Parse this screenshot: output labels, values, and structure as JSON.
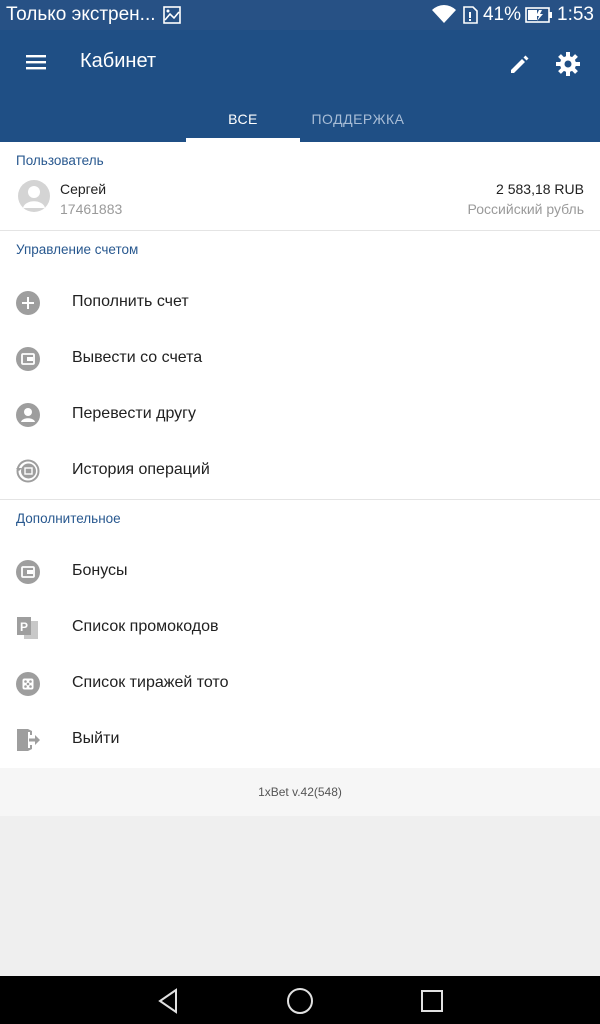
{
  "status_bar": {
    "notification_text": "Только экстрен...",
    "battery": "41%",
    "time": "1:53"
  },
  "app_bar": {
    "title": "Кабинет",
    "tabs": [
      {
        "label": "ВСЕ",
        "selected": true
      },
      {
        "label": "ПОДДЕРЖКА",
        "selected": false
      }
    ]
  },
  "user_section": {
    "label": "Пользователь",
    "name": "Сергей",
    "id": "17461883",
    "balance": "2 583,18 RUB",
    "currency_name": "Российский рубль"
  },
  "account_section": {
    "label": "Управление счетом",
    "items": [
      {
        "label": "Пополнить счет",
        "icon": "add-circle-icon"
      },
      {
        "label": "Вывести со счета",
        "icon": "wallet-icon"
      },
      {
        "label": "Перевести другу",
        "icon": "person-icon"
      },
      {
        "label": "История операций",
        "icon": "history-icon"
      }
    ]
  },
  "extra_section": {
    "label": "Дополнительное",
    "items": [
      {
        "label": "Бонусы",
        "icon": "bonus-wallet-icon"
      },
      {
        "label": "Список промокодов",
        "icon": "promo-code-icon"
      },
      {
        "label": "Список тиражей тото",
        "icon": "dice-icon"
      },
      {
        "label": "Выйти",
        "icon": "logout-icon"
      }
    ]
  },
  "footer": {
    "version": "1xBet v.42(548)"
  },
  "colors": {
    "primary": "#1f4f85",
    "status_bar": "#275185",
    "section_label": "#28588f",
    "icon_gray": "#9e9e9e"
  }
}
